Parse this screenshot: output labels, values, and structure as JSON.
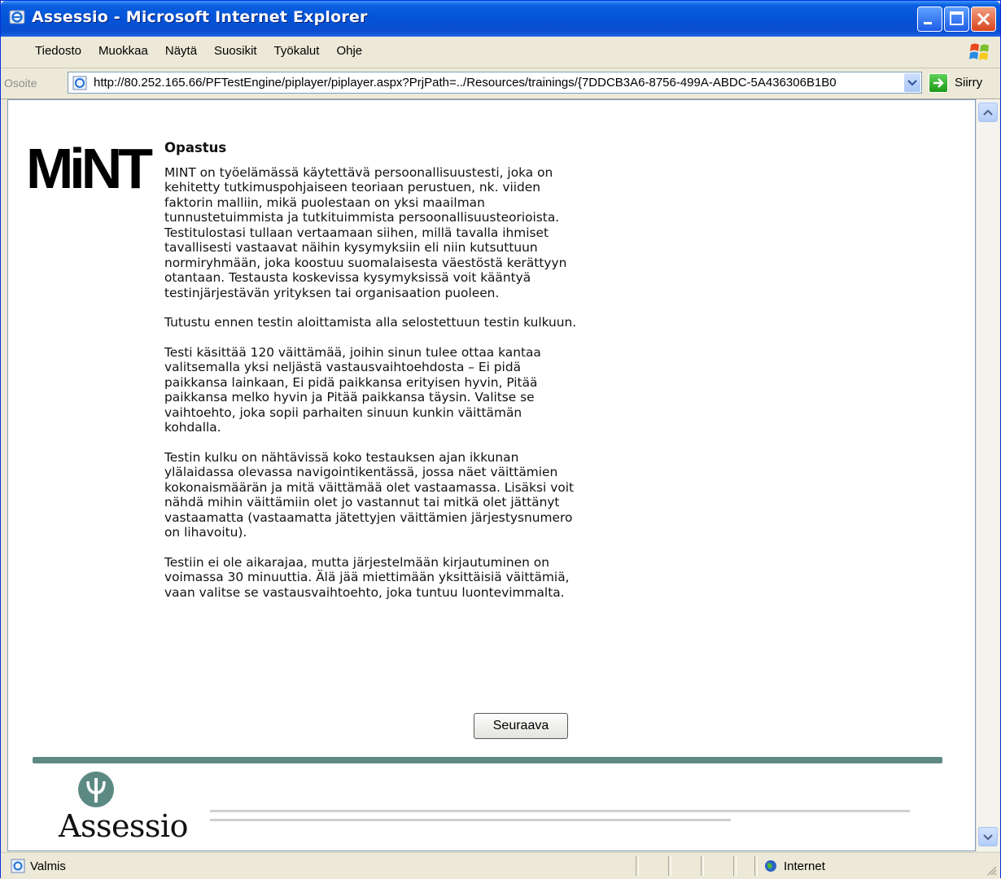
{
  "window": {
    "title": "Assessio - Microsoft Internet Explorer"
  },
  "menu": {
    "items": [
      "Tiedosto",
      "Muokkaa",
      "Näytä",
      "Suosikit",
      "Työkalut",
      "Ohje"
    ]
  },
  "address": {
    "label": "Osoite",
    "url": "http://80.252.165.66/PFTestEngine/piplayer/piplayer.aspx?PrjPath=../Resources/trainings/{7DDCB3A6-8756-499A-ABDC-5A436306B1B0",
    "go_label": "Siirry"
  },
  "content": {
    "logo_text": "MiNT",
    "heading": "Opastus",
    "paragraphs": [
      "MINT on työelämässä käytettävä persoonallisuustesti, joka on kehitetty tutkimuspohjaiseen teoriaan perustuen, nk. viiden faktorin malliin, mikä puolestaan on yksi maailman tunnustetuimmista ja tutkituimmista persoonallisuusteorioista. Testitulostasi tullaan vertaamaan siihen, millä tavalla ihmiset tavallisesti vastaavat näihin kysymyksiin eli niin kutsuttuun normiryhmään, joka koostuu suomalaisesta väestöstä kerättyyn otantaan. Testausta koskevissa kysymyksissä voit kääntyä testinjärjestävän yrityksen tai organisaation puoleen.",
      "Tutustu ennen testin aloittamista alla selostettuun testin kulkuun.",
      "Testi käsittää 120 väittämää, joihin sinun tulee ottaa kantaa valitsemalla yksi neljästä vastausvaihtoehdosta – Ei pidä paikkansa lainkaan, Ei pidä paikkansa erityisen hyvin, Pitää paikkansa melko hyvin ja Pitää paikkansa täysin. Valitse se vaihtoehto, joka sopii parhaiten sinuun kunkin väittämän kohdalla.",
      "Testin kulku on nähtävissä koko testauksen ajan ikkunan ylälaidassa olevassa navigointikentässä, jossa näet väittämien kokonaismäärän ja mitä väittämää olet vastaamassa. Lisäksi voit nähdä mihin väittämiin olet jo vastannut tai mitkä olet jättänyt vastaamatta (vastaamatta jätettyjen väittämien järjestysnumero on lihavoitu).",
      "Testiin ei ole aikarajaa, mutta järjestelmään kirjautuminen on voimassa 30 minuuttia. Älä jää miettimään yksittäisiä väittämiä, vaan valitse se vastausvaihtoehto, joka tuntuu luontevimmalta."
    ],
    "next_button": "Seuraava"
  },
  "footer": {
    "brand": "Assessio"
  },
  "status": {
    "text": "Valmis",
    "zone": "Internet"
  }
}
